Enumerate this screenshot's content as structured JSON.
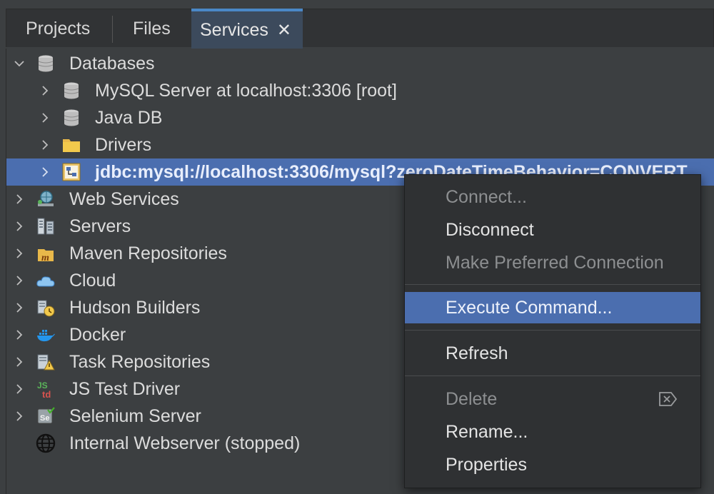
{
  "tabs": {
    "projects": "Projects",
    "files": "Files",
    "services": "Services",
    "close": "✕"
  },
  "tree": {
    "databases": "Databases",
    "mysql": "MySQL Server at localhost:3306 [root]",
    "javadb": "Java DB",
    "drivers": "Drivers",
    "jdbc": "jdbc:mysql://localhost:3306/mysql?zeroDateTimeBehavior=CONVERT_",
    "web_services": "Web Services",
    "servers": "Servers",
    "maven": "Maven Repositories",
    "cloud": "Cloud",
    "hudson": "Hudson Builders",
    "docker": "Docker",
    "task_repos": "Task Repositories",
    "js_test": "JS Test Driver",
    "selenium": "Selenium Server",
    "webserver": "Internal Webserver (stopped)"
  },
  "menu": {
    "connect": "Connect...",
    "disconnect": "Disconnect",
    "make_preferred": "Make Preferred Connection",
    "execute": "Execute Command...",
    "refresh": "Refresh",
    "delete": "Delete",
    "rename": "Rename...",
    "properties": "Properties"
  },
  "colors": {
    "selection": "#4b6eaf",
    "tab_accent": "#4a88c7",
    "background": "#3c3f41",
    "menu_background": "#2f3133"
  },
  "icons": {
    "expand": "chevron-right-icon",
    "collapse": "chevron-down-icon",
    "database": "database-icon",
    "folder": "folder-icon",
    "connection": "connection-icon",
    "web_services": "web-services-icon",
    "servers": "servers-icon",
    "maven": "maven-icon",
    "cloud": "cloud-icon",
    "hudson": "hudson-icon",
    "docker": "docker-icon",
    "task": "task-repository-icon",
    "js_test": "js-test-driver-icon",
    "selenium": "selenium-icon",
    "globe": "globe-icon",
    "delete_key": "delete-key-icon"
  }
}
